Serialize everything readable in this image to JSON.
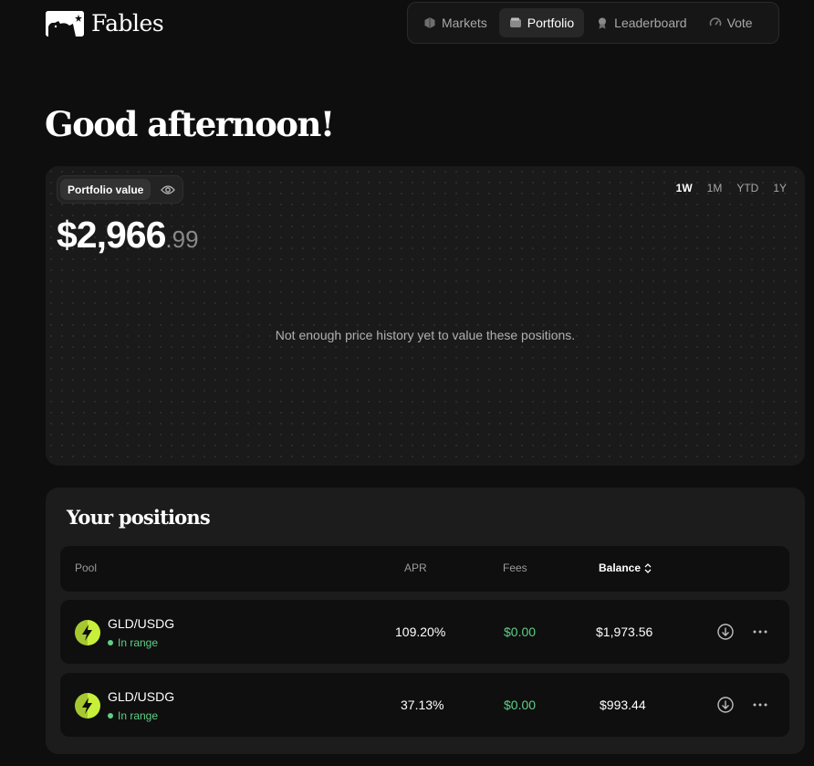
{
  "brand": {
    "name": "Fables"
  },
  "nav": [
    {
      "label": "Markets",
      "icon": "cube-icon",
      "active": false
    },
    {
      "label": "Portfolio",
      "icon": "wallet-icon",
      "active": true
    },
    {
      "label": "Leaderboard",
      "icon": "medal-icon",
      "active": false
    },
    {
      "label": "Vote",
      "icon": "gauge-icon",
      "active": false
    }
  ],
  "greeting": "Good afternoon!",
  "portfolio": {
    "label": "Portfolio value",
    "value_main": "$2,966",
    "value_cents": ".99",
    "ranges": [
      "1W",
      "1M",
      "YTD",
      "1Y"
    ],
    "active_range": "1W",
    "empty_message": "Not enough price history yet to value these positions."
  },
  "positions": {
    "title": "Your positions",
    "columns": {
      "pool": "Pool",
      "apr": "APR",
      "fees": "Fees",
      "balance": "Balance"
    },
    "rows": [
      {
        "pool": "GLD/USDG",
        "status": "In range",
        "apr": "109.20%",
        "fees": "$0.00",
        "balance": "$1,973.56"
      },
      {
        "pool": "GLD/USDG",
        "status": "In range",
        "apr": "37.13%",
        "fees": "$0.00",
        "balance": "$993.44"
      }
    ]
  },
  "colors": {
    "accent_green": "#5fcf86",
    "token_yellow": "#c8f03a",
    "background": "#0e0e0e"
  }
}
